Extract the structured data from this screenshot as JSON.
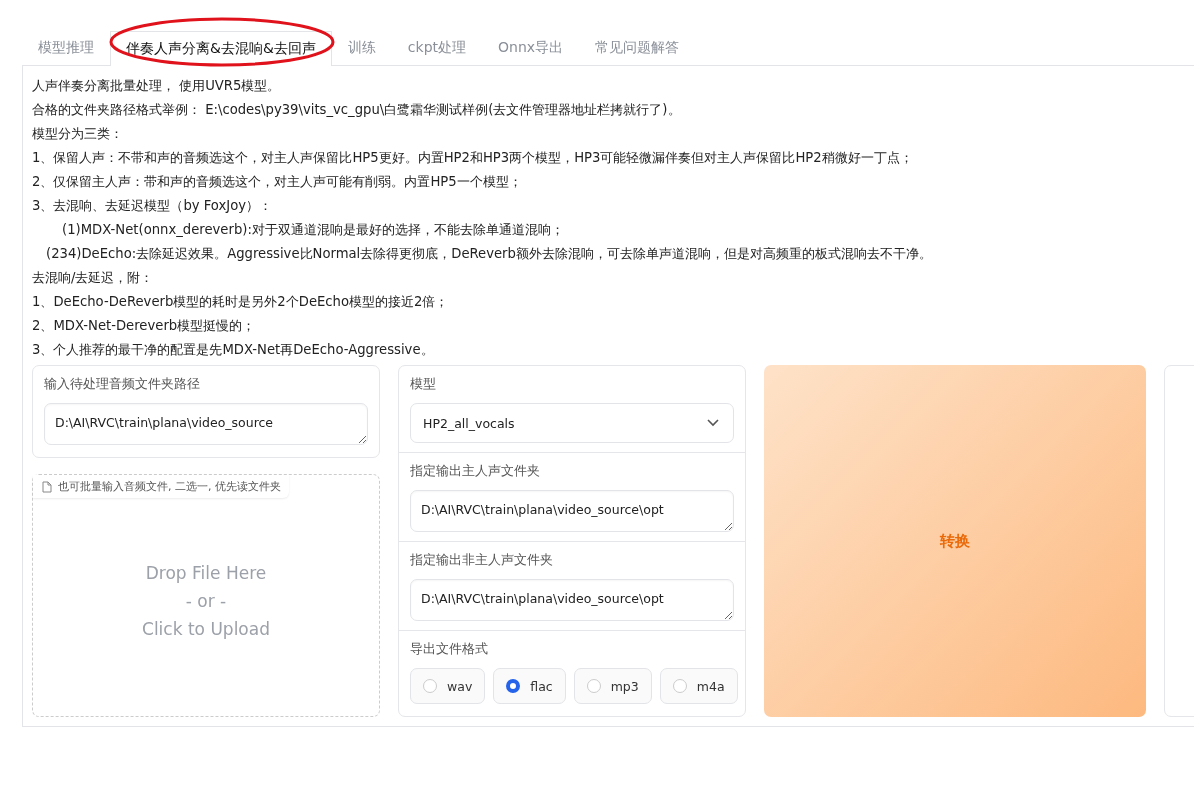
{
  "tabs": [
    {
      "label": "模型推理",
      "selected": false
    },
    {
      "label": "伴奏人声分离&去混响&去回声",
      "selected": true
    },
    {
      "label": "训练",
      "selected": false
    },
    {
      "label": "ckpt处理",
      "selected": false
    },
    {
      "label": "Onnx导出",
      "selected": false
    },
    {
      "label": "常见问题解答",
      "selected": false
    }
  ],
  "description": [
    {
      "kind": "plain",
      "text": "人声伴奏分离批量处理， 使用UVR5模型。"
    },
    {
      "kind": "plain",
      "text": "合格的文件夹路径格式举例： E:\\codes\\py39\\vits_vc_gpu\\白鹭霜华测试样例(去文件管理器地址栏拷就行了)。"
    },
    {
      "kind": "plain",
      "text": "模型分为三类："
    },
    {
      "kind": "plain",
      "text": "1、保留人声：不带和声的音频选这个，对主人声保留比HP5更好。内置HP2和HP3两个模型，HP3可能轻微漏伴奏但对主人声保留比HP2稍微好一丁点；"
    },
    {
      "kind": "plain",
      "text": "2、仅保留主人声：带和声的音频选这个，对主人声可能有削弱。内置HP5一个模型；"
    },
    {
      "kind": "plain",
      "text": "3、去混响、去延迟模型（by FoxJoy）："
    },
    {
      "kind": "wide",
      "text": "(1)MDX-Net(onnx_dereverb):对于双通道混响是最好的选择，不能去除单通道混响；"
    },
    {
      "kind": "narrow",
      "text": "(234)DeEcho:去除延迟效果。Aggressive比Normal去除得更彻底，DeReverb额外去除混响，可去除单声道混响，但是对高频重的板式混响去不干净。"
    },
    {
      "kind": "plain",
      "text": "去混响/去延迟，附："
    },
    {
      "kind": "plain",
      "text": "1、DeEcho-DeReverb模型的耗时是另外2个DeEcho模型的接近2倍；"
    },
    {
      "kind": "plain",
      "text": "2、MDX-Net-Dereverb模型挺慢的；"
    },
    {
      "kind": "plain",
      "text": "3、个人推荐的最干净的配置是先MDX-Net再DeEcho-Aggressive。"
    }
  ],
  "input_folder": {
    "label": "输入待处理音频文件夹路径",
    "value": "D:\\AI\\RVC\\train\\plana\\video_source"
  },
  "upload": {
    "label": "也可批量输入音频文件, 二选一, 优先读文件夹",
    "drop_text": [
      "Drop File Here",
      "- or -",
      "Click to Upload"
    ]
  },
  "model": {
    "label": "模型",
    "value": "HP2_all_vocals"
  },
  "vocal_output": {
    "label": "指定输出主人声文件夹",
    "value": "D:\\AI\\RVC\\train\\plana\\video_source\\opt"
  },
  "other_output": {
    "label": "指定输出非主人声文件夹",
    "value": "D:\\AI\\RVC\\train\\plana\\video_source\\opt"
  },
  "format": {
    "label": "导出文件格式",
    "options": [
      {
        "label": "wav",
        "selected": false
      },
      {
        "label": "flac",
        "selected": true
      },
      {
        "label": "mp3",
        "selected": false
      },
      {
        "label": "m4a",
        "selected": false
      }
    ]
  },
  "convert_button": "转换"
}
